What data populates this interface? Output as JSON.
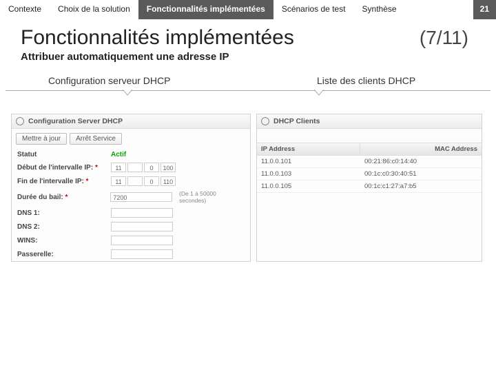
{
  "nav": {
    "tabs": [
      "Contexte",
      "Choix de la solution",
      "Fonctionnalités implémentées",
      "Scénarios de test",
      "Synthèse"
    ],
    "active_index": 2,
    "page_number": "21"
  },
  "title": "Fonctionnalités implémentées",
  "counter": "(7/11)",
  "subtitle": "Attribuer automatiquement une adresse IP",
  "subheads": {
    "left": "Configuration serveur DHCP",
    "right": "Liste des clients DHCP"
  },
  "left_panel": {
    "heading": "Configuration Server DHCP",
    "btn_update": "Mettre à jour",
    "btn_stop": "Arrêt Service",
    "rows": {
      "status_label": "Statut",
      "status_value": "Actif",
      "range_start_label": "Début de l'intervalle IP:",
      "range_end_label": "Fin de l'intervalle IP:",
      "lease_label": "Durée du bail:",
      "lease_value": "7200",
      "lease_hint": "(De 1 à 50000 secondes)",
      "dns1_label": "DNS 1:",
      "dns2_label": "DNS 2:",
      "wins_label": "WINS:",
      "gateway_label": "Passerelle:"
    },
    "ip_start": [
      "11",
      "",
      "0",
      "100"
    ],
    "ip_end": [
      "11",
      "",
      "0",
      "110"
    ]
  },
  "right_panel": {
    "heading": "DHCP Clients",
    "col_ip": "IP Address",
    "col_mac": "MAC Address",
    "rows": [
      {
        "ip": "11.0.0.101",
        "mac": "00:21:86:c0:14:40"
      },
      {
        "ip": "11.0.0.103",
        "mac": "00:1c:c0:30:40:51"
      },
      {
        "ip": "11.0.0.105",
        "mac": "00:1c:c1:27:a7:b5"
      }
    ]
  }
}
